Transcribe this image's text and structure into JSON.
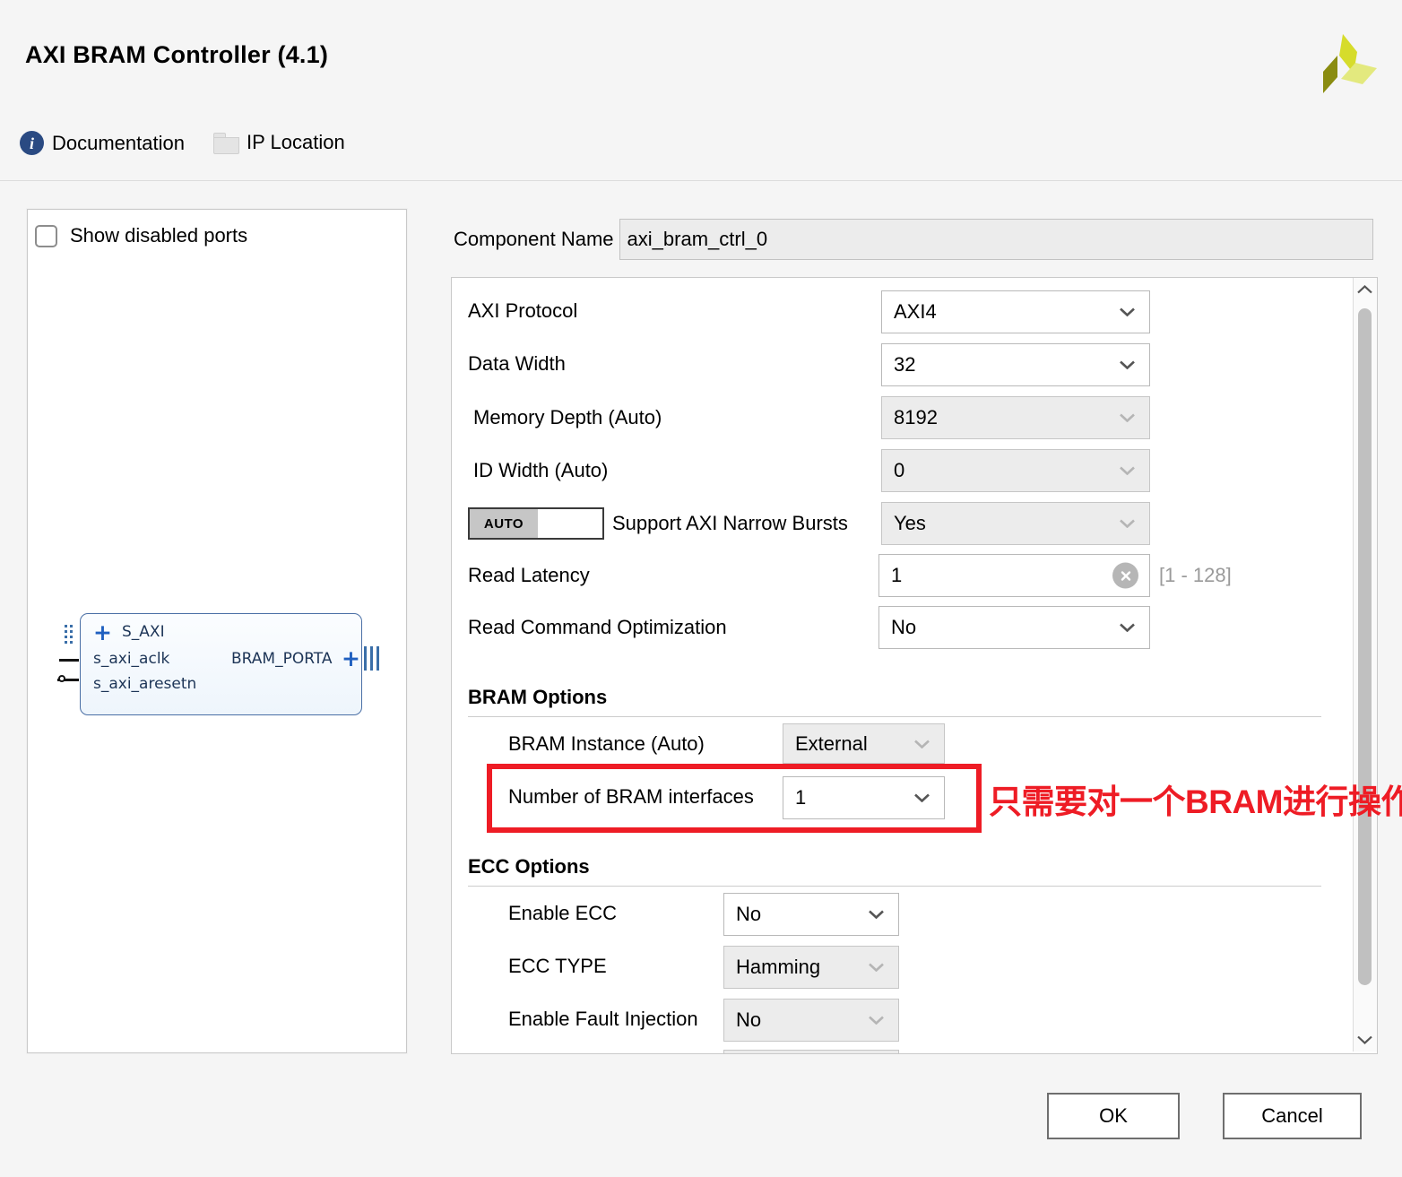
{
  "window": {
    "title": "AXI BRAM Controller (4.1)",
    "logo_icon": "amd-xilinx-pinwheel-logo",
    "logo_colors": {
      "dark": "#8a8c10",
      "mid": "#d6dc2b",
      "light": "#e3e97e"
    }
  },
  "links": [
    {
      "label": "Documentation",
      "icon": "info-circle-icon"
    },
    {
      "label": "IP Location",
      "icon": "folder-icon"
    }
  ],
  "ports_panel": {
    "show_disabled_ports": {
      "label": "Show disabled ports",
      "checked": false
    },
    "block": {
      "interfaces": [
        {
          "name": "S_AXI",
          "side": "left",
          "type": "bus",
          "expander": "+"
        },
        {
          "name": "s_axi_aclk",
          "side": "left",
          "type": "pin"
        },
        {
          "name": "s_axi_aresetn",
          "side": "left",
          "type": "pin-inverted"
        },
        {
          "name": "BRAM_PORTA",
          "side": "right",
          "type": "bus",
          "expander": "+"
        }
      ]
    }
  },
  "component": {
    "label": "Component Name",
    "value": "axi_bram_ctrl_0"
  },
  "fields": [
    {
      "label": "AXI Protocol",
      "value": "AXI4",
      "control": "dropdown",
      "disabled": false
    },
    {
      "label": "Data Width",
      "value": "32",
      "control": "dropdown",
      "disabled": false
    },
    {
      "label": "Memory Depth (Auto)",
      "value": "8192",
      "control": "dropdown",
      "disabled": true
    },
    {
      "label": "ID Width (Auto)",
      "value": "0",
      "control": "dropdown",
      "disabled": true
    },
    {
      "label": "Support AXI Narrow Bursts",
      "value": "Yes",
      "control": "dropdown",
      "disabled": true,
      "auto_toggle": "AUTO"
    },
    {
      "label": "Read Latency",
      "value": "1",
      "control": "text",
      "disabled": false,
      "range_hint": "[1 - 128]",
      "clear_icon": "clear-circle-icon"
    },
    {
      "label": "Read Command Optimization",
      "value": "No",
      "control": "dropdown",
      "disabled": false
    }
  ],
  "bram_options": {
    "heading": "BRAM Options",
    "fields": [
      {
        "label": "BRAM Instance (Auto)",
        "value": "External",
        "control": "dropdown",
        "disabled": true
      },
      {
        "label": "Number of BRAM interfaces",
        "value": "1",
        "control": "dropdown",
        "disabled": false
      }
    ]
  },
  "ecc_options": {
    "heading": "ECC Options",
    "fields": [
      {
        "label": "Enable ECC",
        "value": "No",
        "control": "dropdown",
        "disabled": false
      },
      {
        "label": "ECC TYPE",
        "value": "Hamming",
        "control": "dropdown",
        "disabled": true
      },
      {
        "label": "Enable Fault Injection",
        "value": "No",
        "control": "dropdown",
        "disabled": true
      }
    ]
  },
  "annotation": {
    "text": "只需要对一个BRAM进行操作",
    "color": "#ee1c25"
  },
  "footer": {
    "ok_label": "OK",
    "cancel_label": "Cancel"
  }
}
